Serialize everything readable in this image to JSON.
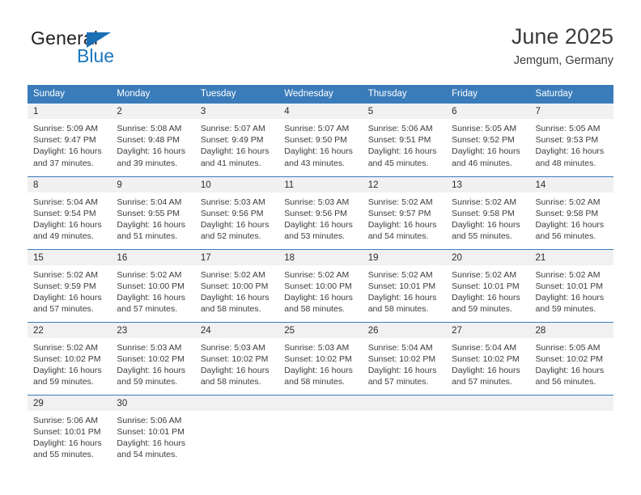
{
  "logo": {
    "word1": "General",
    "word2": "Blue",
    "triangle_color": "#1b6fb5",
    "blue_color": "#1b76bc"
  },
  "header": {
    "title": "June 2025",
    "subtitle": "Jemgum, Germany"
  },
  "theme": {
    "header_blue": "#3a7cba",
    "daynum_bg": "#f1f1f1",
    "text": "#3c3c3c"
  },
  "weekday_headers": [
    "Sunday",
    "Monday",
    "Tuesday",
    "Wednesday",
    "Thursday",
    "Friday",
    "Saturday"
  ],
  "weeks": [
    [
      {
        "day": "1",
        "sunrise": "Sunrise: 5:09 AM",
        "sunset": "Sunset: 9:47 PM",
        "daylight1": "Daylight: 16 hours",
        "daylight2": "and 37 minutes."
      },
      {
        "day": "2",
        "sunrise": "Sunrise: 5:08 AM",
        "sunset": "Sunset: 9:48 PM",
        "daylight1": "Daylight: 16 hours",
        "daylight2": "and 39 minutes."
      },
      {
        "day": "3",
        "sunrise": "Sunrise: 5:07 AM",
        "sunset": "Sunset: 9:49 PM",
        "daylight1": "Daylight: 16 hours",
        "daylight2": "and 41 minutes."
      },
      {
        "day": "4",
        "sunrise": "Sunrise: 5:07 AM",
        "sunset": "Sunset: 9:50 PM",
        "daylight1": "Daylight: 16 hours",
        "daylight2": "and 43 minutes."
      },
      {
        "day": "5",
        "sunrise": "Sunrise: 5:06 AM",
        "sunset": "Sunset: 9:51 PM",
        "daylight1": "Daylight: 16 hours",
        "daylight2": "and 45 minutes."
      },
      {
        "day": "6",
        "sunrise": "Sunrise: 5:05 AM",
        "sunset": "Sunset: 9:52 PM",
        "daylight1": "Daylight: 16 hours",
        "daylight2": "and 46 minutes."
      },
      {
        "day": "7",
        "sunrise": "Sunrise: 5:05 AM",
        "sunset": "Sunset: 9:53 PM",
        "daylight1": "Daylight: 16 hours",
        "daylight2": "and 48 minutes."
      }
    ],
    [
      {
        "day": "8",
        "sunrise": "Sunrise: 5:04 AM",
        "sunset": "Sunset: 9:54 PM",
        "daylight1": "Daylight: 16 hours",
        "daylight2": "and 49 minutes."
      },
      {
        "day": "9",
        "sunrise": "Sunrise: 5:04 AM",
        "sunset": "Sunset: 9:55 PM",
        "daylight1": "Daylight: 16 hours",
        "daylight2": "and 51 minutes."
      },
      {
        "day": "10",
        "sunrise": "Sunrise: 5:03 AM",
        "sunset": "Sunset: 9:56 PM",
        "daylight1": "Daylight: 16 hours",
        "daylight2": "and 52 minutes."
      },
      {
        "day": "11",
        "sunrise": "Sunrise: 5:03 AM",
        "sunset": "Sunset: 9:56 PM",
        "daylight1": "Daylight: 16 hours",
        "daylight2": "and 53 minutes."
      },
      {
        "day": "12",
        "sunrise": "Sunrise: 5:02 AM",
        "sunset": "Sunset: 9:57 PM",
        "daylight1": "Daylight: 16 hours",
        "daylight2": "and 54 minutes."
      },
      {
        "day": "13",
        "sunrise": "Sunrise: 5:02 AM",
        "sunset": "Sunset: 9:58 PM",
        "daylight1": "Daylight: 16 hours",
        "daylight2": "and 55 minutes."
      },
      {
        "day": "14",
        "sunrise": "Sunrise: 5:02 AM",
        "sunset": "Sunset: 9:58 PM",
        "daylight1": "Daylight: 16 hours",
        "daylight2": "and 56 minutes."
      }
    ],
    [
      {
        "day": "15",
        "sunrise": "Sunrise: 5:02 AM",
        "sunset": "Sunset: 9:59 PM",
        "daylight1": "Daylight: 16 hours",
        "daylight2": "and 57 minutes."
      },
      {
        "day": "16",
        "sunrise": "Sunrise: 5:02 AM",
        "sunset": "Sunset: 10:00 PM",
        "daylight1": "Daylight: 16 hours",
        "daylight2": "and 57 minutes."
      },
      {
        "day": "17",
        "sunrise": "Sunrise: 5:02 AM",
        "sunset": "Sunset: 10:00 PM",
        "daylight1": "Daylight: 16 hours",
        "daylight2": "and 58 minutes."
      },
      {
        "day": "18",
        "sunrise": "Sunrise: 5:02 AM",
        "sunset": "Sunset: 10:00 PM",
        "daylight1": "Daylight: 16 hours",
        "daylight2": "and 58 minutes."
      },
      {
        "day": "19",
        "sunrise": "Sunrise: 5:02 AM",
        "sunset": "Sunset: 10:01 PM",
        "daylight1": "Daylight: 16 hours",
        "daylight2": "and 58 minutes."
      },
      {
        "day": "20",
        "sunrise": "Sunrise: 5:02 AM",
        "sunset": "Sunset: 10:01 PM",
        "daylight1": "Daylight: 16 hours",
        "daylight2": "and 59 minutes."
      },
      {
        "day": "21",
        "sunrise": "Sunrise: 5:02 AM",
        "sunset": "Sunset: 10:01 PM",
        "daylight1": "Daylight: 16 hours",
        "daylight2": "and 59 minutes."
      }
    ],
    [
      {
        "day": "22",
        "sunrise": "Sunrise: 5:02 AM",
        "sunset": "Sunset: 10:02 PM",
        "daylight1": "Daylight: 16 hours",
        "daylight2": "and 59 minutes."
      },
      {
        "day": "23",
        "sunrise": "Sunrise: 5:03 AM",
        "sunset": "Sunset: 10:02 PM",
        "daylight1": "Daylight: 16 hours",
        "daylight2": "and 59 minutes."
      },
      {
        "day": "24",
        "sunrise": "Sunrise: 5:03 AM",
        "sunset": "Sunset: 10:02 PM",
        "daylight1": "Daylight: 16 hours",
        "daylight2": "and 58 minutes."
      },
      {
        "day": "25",
        "sunrise": "Sunrise: 5:03 AM",
        "sunset": "Sunset: 10:02 PM",
        "daylight1": "Daylight: 16 hours",
        "daylight2": "and 58 minutes."
      },
      {
        "day": "26",
        "sunrise": "Sunrise: 5:04 AM",
        "sunset": "Sunset: 10:02 PM",
        "daylight1": "Daylight: 16 hours",
        "daylight2": "and 57 minutes."
      },
      {
        "day": "27",
        "sunrise": "Sunrise: 5:04 AM",
        "sunset": "Sunset: 10:02 PM",
        "daylight1": "Daylight: 16 hours",
        "daylight2": "and 57 minutes."
      },
      {
        "day": "28",
        "sunrise": "Sunrise: 5:05 AM",
        "sunset": "Sunset: 10:02 PM",
        "daylight1": "Daylight: 16 hours",
        "daylight2": "and 56 minutes."
      }
    ],
    [
      {
        "day": "29",
        "sunrise": "Sunrise: 5:06 AM",
        "sunset": "Sunset: 10:01 PM",
        "daylight1": "Daylight: 16 hours",
        "daylight2": "and 55 minutes."
      },
      {
        "day": "30",
        "sunrise": "Sunrise: 5:06 AM",
        "sunset": "Sunset: 10:01 PM",
        "daylight1": "Daylight: 16 hours",
        "daylight2": "and 54 minutes."
      },
      {
        "day": "",
        "sunrise": "",
        "sunset": "",
        "daylight1": "",
        "daylight2": ""
      },
      {
        "day": "",
        "sunrise": "",
        "sunset": "",
        "daylight1": "",
        "daylight2": ""
      },
      {
        "day": "",
        "sunrise": "",
        "sunset": "",
        "daylight1": "",
        "daylight2": ""
      },
      {
        "day": "",
        "sunrise": "",
        "sunset": "",
        "daylight1": "",
        "daylight2": ""
      },
      {
        "day": "",
        "sunrise": "",
        "sunset": "",
        "daylight1": "",
        "daylight2": ""
      }
    ]
  ]
}
